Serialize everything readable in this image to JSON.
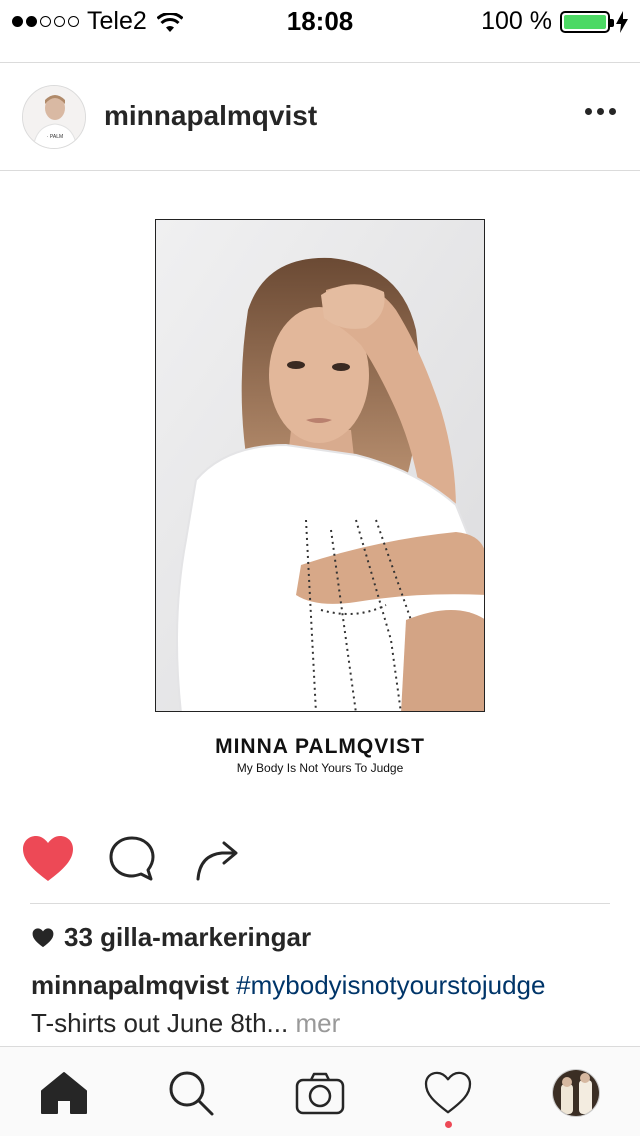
{
  "status_bar": {
    "carrier": "Tele2",
    "time": "18:08",
    "battery": "100 %",
    "signal_bars_on": 2,
    "signal_bars_total": 5
  },
  "post": {
    "username": "minnapalmqvist",
    "image_title": "MINNA PALMQVIST",
    "image_subtitle": "My Body Is Not Yours To Judge",
    "likes": "33 gilla-markeringar",
    "caption_user": "minnapalmqvist",
    "caption_hashtag": "#mybodyisnotyourstojudge",
    "caption_text": "T-shirts out June 8th...",
    "more_label": "mer",
    "liked": true
  },
  "icons": {
    "like": "heart-icon",
    "comment": "comment-icon",
    "share": "share-arrow-icon",
    "home": "home-icon",
    "search": "search-icon",
    "camera": "camera-icon",
    "activity": "heart-outline-icon"
  },
  "colors": {
    "like_red": "#ed4956",
    "hashtag_blue": "#003569",
    "battery_green": "#4cd964",
    "muted_gray": "#999999"
  }
}
